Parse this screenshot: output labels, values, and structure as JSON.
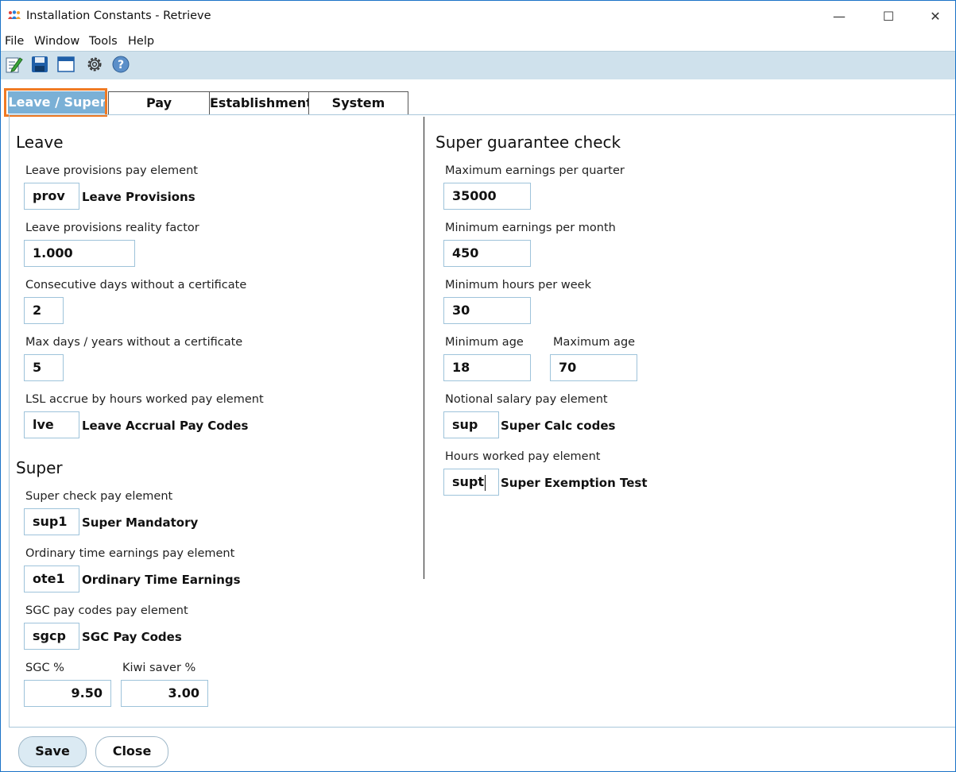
{
  "window": {
    "title": "Installation Constants - Retrieve"
  },
  "menu": [
    "File",
    "Window",
    "Tools",
    "Help"
  ],
  "toolbar": {
    "icons": [
      "edit-icon",
      "save-icon",
      "window-icon",
      "settings-icon",
      "help-icon"
    ]
  },
  "tabs": [
    "Leave / Super",
    "Pay",
    "Establishment",
    "System"
  ],
  "leave": {
    "title": "Leave",
    "provisions_label": "Leave provisions pay element",
    "provisions_value": "prov",
    "provisions_desc": "Leave Provisions",
    "reality_label": "Leave provisions reality factor",
    "reality_value": "1.000",
    "consecutive_label": "Consecutive days without a certificate",
    "consecutive_value": "2",
    "max_days_label": "Max days / years without a certificate",
    "max_days_value": "5",
    "lsl_label": "LSL accrue by hours worked pay element",
    "lsl_value": "lve",
    "lsl_desc": "Leave Accrual Pay Codes"
  },
  "super": {
    "title": "Super",
    "check_label": "Super check pay element",
    "check_value": "sup1",
    "check_desc": "Super Mandatory",
    "ote_label": "Ordinary time earnings pay element",
    "ote_value": "ote1",
    "ote_desc": "Ordinary Time Earnings",
    "sgc_codes_label": "SGC pay codes pay element",
    "sgc_codes_value": "sgcp",
    "sgc_codes_desc": "SGC Pay Codes",
    "sgc_pct_label": "SGC %",
    "sgc_pct_value": "9.50",
    "kiwi_label": "Kiwi saver %",
    "kiwi_value": "3.00"
  },
  "sgc_check": {
    "title": "Super guarantee check",
    "max_earn_label": "Maximum earnings per quarter",
    "max_earn_value": "35000",
    "min_earn_label": "Minimum earnings per month",
    "min_earn_value": "450",
    "min_hours_label": "Minimum hours per week",
    "min_hours_value": "30",
    "min_age_label": "Minimum age",
    "min_age_value": "18",
    "max_age_label": "Maximum age",
    "max_age_value": "70",
    "notional_label": "Notional salary pay element",
    "notional_value": "sup",
    "notional_desc": "Super Calc codes",
    "hours_label": "Hours worked pay element",
    "hours_value": "supt",
    "hours_desc": "Super Exemption Test"
  },
  "buttons": {
    "save": "Save",
    "close": "Close"
  },
  "colors": {
    "toolbar": "#cfe1ec",
    "active_tab": "#7ab0d6",
    "focus": "#f07a23",
    "border": "#1a73c7"
  }
}
